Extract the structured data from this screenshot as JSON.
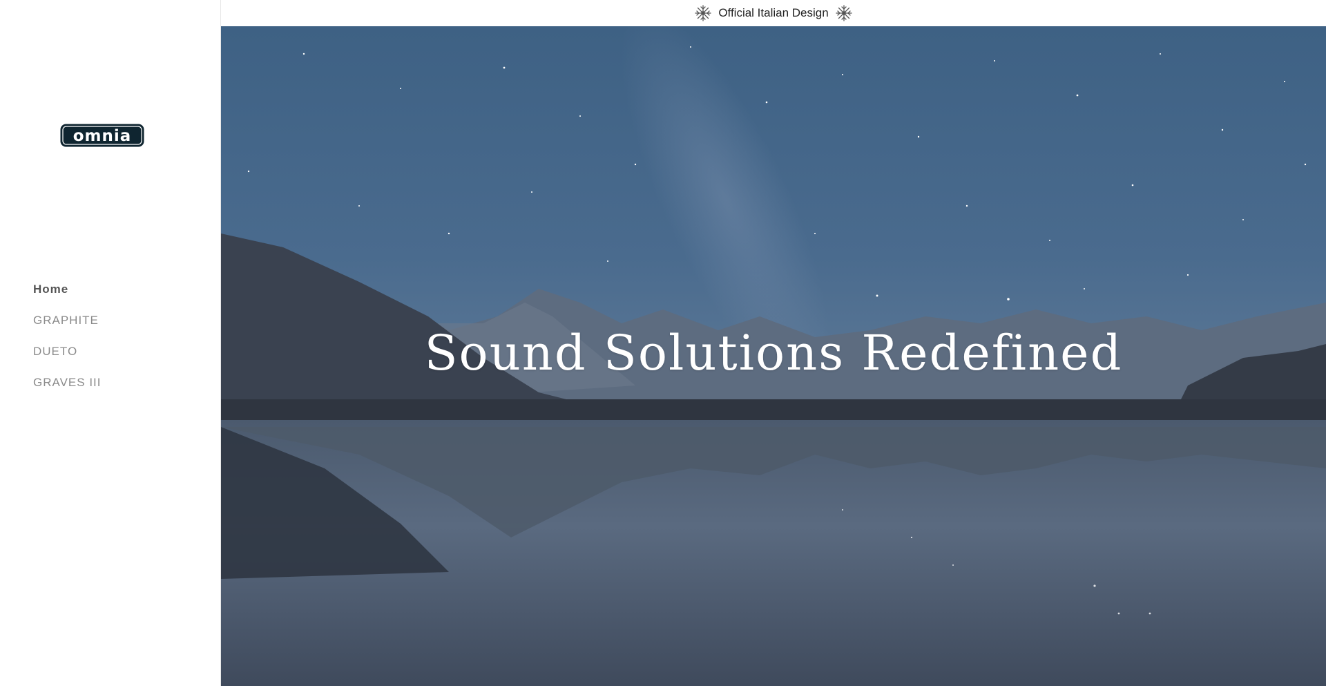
{
  "brand": {
    "logo_text": "omnia",
    "logo_color": "#0f2530"
  },
  "topbar": {
    "text": "Official Italian Design",
    "icon": "snowflake-icon"
  },
  "nav": {
    "items": [
      {
        "label": "Home",
        "active": true
      },
      {
        "label": "GRAPHITE",
        "active": false
      },
      {
        "label": "DUETO",
        "active": false
      },
      {
        "label": "GRAVES III",
        "active": false
      }
    ]
  },
  "hero": {
    "title": "Sound Solutions Redefined"
  }
}
